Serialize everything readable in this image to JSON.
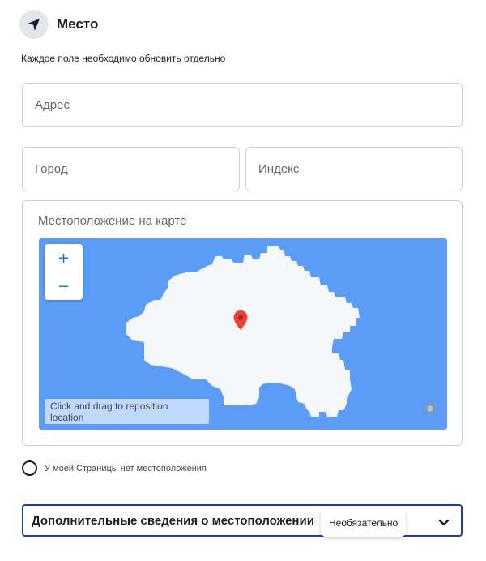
{
  "header": {
    "title": "Место",
    "icon": "location-arrow-icon"
  },
  "hint": "Каждое поле необходимо обновить отдельно",
  "fields": {
    "address": {
      "placeholder": "Адрес",
      "value": ""
    },
    "city": {
      "placeholder": "Город",
      "value": ""
    },
    "zip": {
      "placeholder": "Индекс",
      "value": ""
    }
  },
  "map": {
    "label": "Местоположение на карте",
    "zoom_in": "+",
    "zoom_out": "−",
    "drag_hint": "Click and drag to reposition location",
    "water_color": "#5b9cf6",
    "land_color": "#f5f6f7",
    "pin_color": "#ea4335"
  },
  "no_location": {
    "label": "У моей Страницы нет местоположения",
    "checked": false
  },
  "details": {
    "title": "Дополнительные сведения о местоположении",
    "optional": "Необязательно",
    "icon": "chevron-down-icon"
  },
  "colors": {
    "accent_border": "#1f3ea8",
    "text": "#1c1e21",
    "secondary_text": "#65676b",
    "border": "#ced0d4"
  }
}
